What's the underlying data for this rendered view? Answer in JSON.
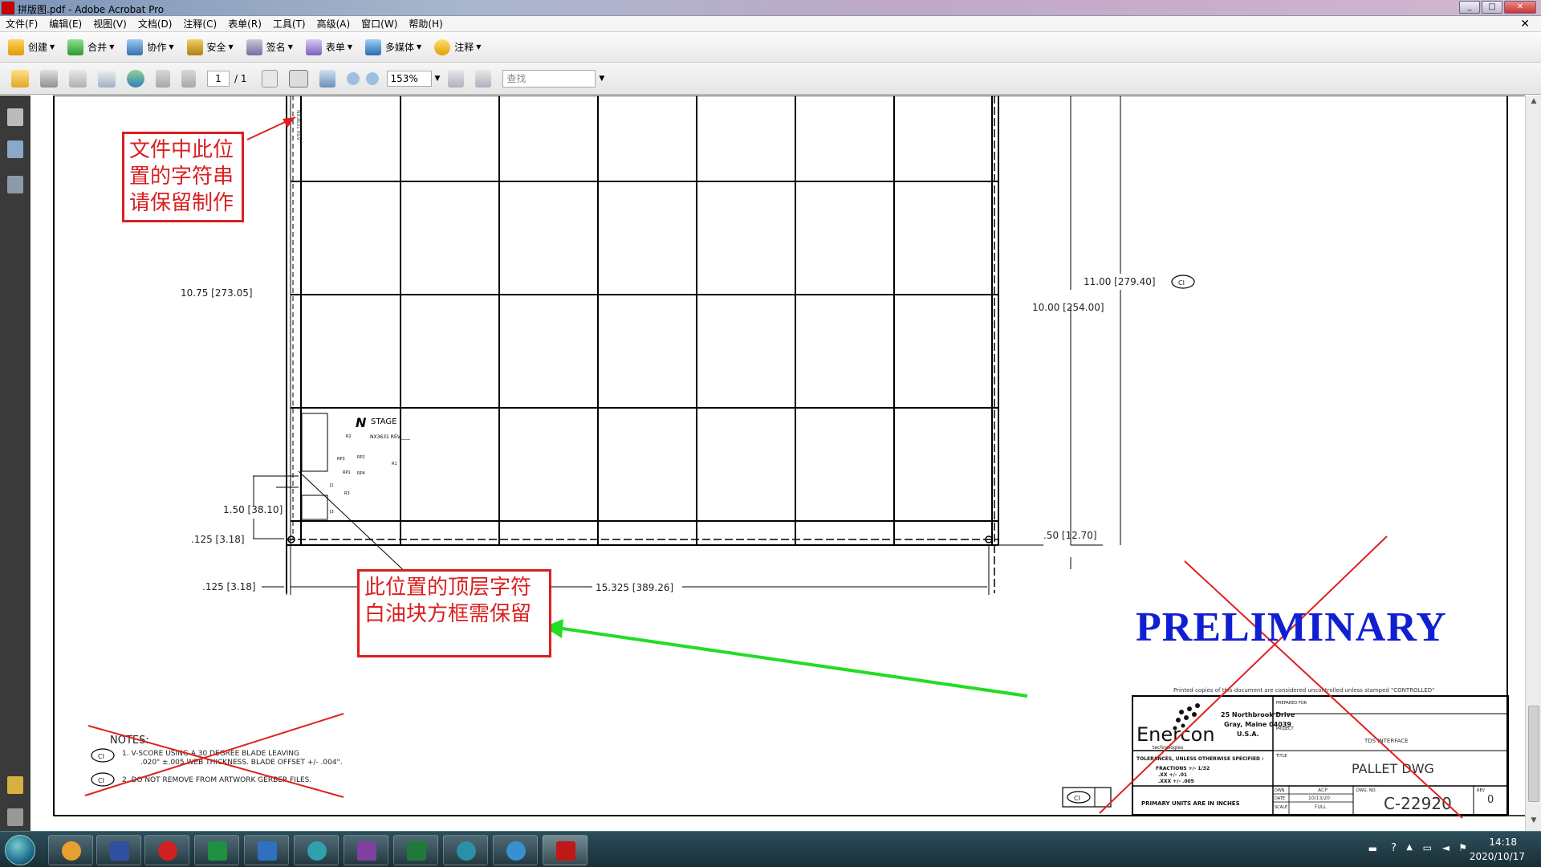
{
  "window": {
    "title": "拼版图.pdf - Adobe Acrobat Pro"
  },
  "menu": [
    "文件(F)",
    "编辑(E)",
    "视图(V)",
    "文档(D)",
    "注释(C)",
    "表单(R)",
    "工具(T)",
    "高级(A)",
    "窗口(W)",
    "帮助(H)"
  ],
  "toolbar": {
    "create": "创建",
    "combine": "合并",
    "collaborate": "协作",
    "secure": "安全",
    "sign": "签名",
    "forms": "表单",
    "multimedia": "多媒体",
    "comment": "注释"
  },
  "nav": {
    "page_current": "1",
    "page_total": "/ 1",
    "zoom": "153%",
    "search_placeholder": "查找"
  },
  "drawing": {
    "dim_left_height": "10.75 [273.05]",
    "dim_right_outer": "11.00 [279.40]",
    "dim_right_inner": "10.00 [254.00]",
    "dim_150": "1.50 [38.10]",
    "dim_125_a": ".125 [3.18]",
    "dim_125_b": ".125 [3.18]",
    "dim_width": "15.325 [389.26]",
    "dim_50": ".50 [12.70]",
    "ci_label": "CI",
    "stage_brand": "STAGE",
    "stage_part": "NX3631 REV____",
    "notes_title": "NOTES:",
    "note1_line1": "1.  V-SCORE USING A 30 DEGREE BLADE LEAVING",
    "note1_line2": ".020\" ±.005 WEB THICKNESS.  BLADE OFFSET +/- .004\".",
    "note2": "2.  DO NOT REMOVE FROM ARTWORK GERBER FILES.",
    "printed_note": "Printed copies of this document are considered uncontrolled unless stamped \"CONTROLLED\"",
    "enercon": "Enercon",
    "enercon_sub": "technologies",
    "address1": "25 Northbrook Drive",
    "address2": "Gray, Maine 04039",
    "address3": "U.S.A.",
    "prepared_for": "PREPARED FOR",
    "project": "PROJECT",
    "project_value": "TDS INTERFACE",
    "title_label": "TITLE",
    "title_value": "PALLET DWG",
    "tolerances": "TOLERANCES, UNLESS OTHERWISE SPECIFIED :",
    "fractions": "FRACTIONS  +/- 1/32",
    "xx": ".XX   +/- .01",
    "xxx": ".XXX  +/- .005",
    "primary_units": "PRIMARY UNITS ARE IN INCHES",
    "dwn": "DWN",
    "dwn_value": "ACP",
    "date": "DATE",
    "date_value": "10/13/20",
    "scale": "SCALE",
    "scale_value": "FULL",
    "dwg_no": "DWG. NO.",
    "dwg_no_value": "C-22920",
    "rev": "REV",
    "rev_value": "0"
  },
  "annotations": {
    "note_top": [
      "文件中此位",
      "置的字符串",
      "请保留制作"
    ],
    "note_bottom": [
      "此位置的顶层字符",
      "白油块方框需保留"
    ],
    "preliminary": "PRELIMINARY"
  },
  "taskbar": {
    "time": "14:18",
    "date": "2020/10/17"
  },
  "colors": {
    "annotation_red": "#d92020",
    "arrow_green": "#22dd22",
    "preliminary_blue": "#1020d0"
  }
}
